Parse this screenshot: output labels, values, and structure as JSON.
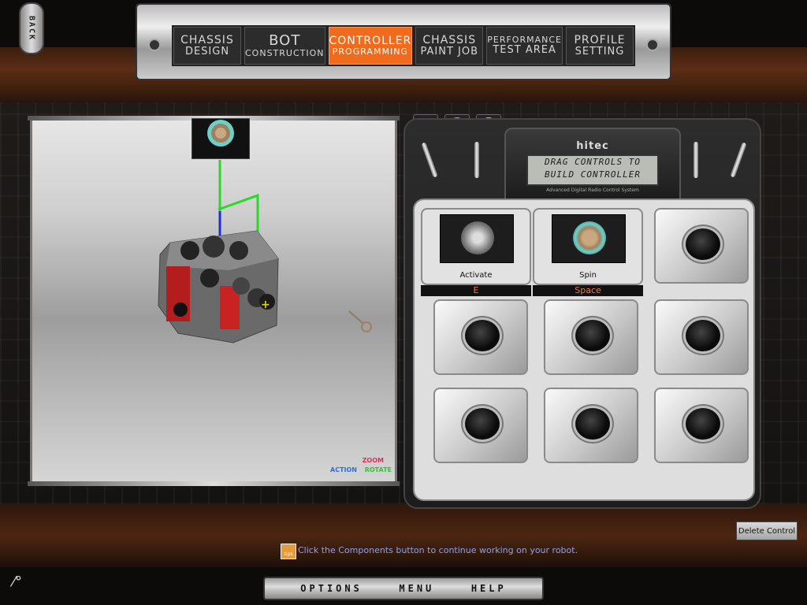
{
  "back": {
    "label": "BACK"
  },
  "nav": {
    "tabs": [
      {
        "line1": "CHASSIS",
        "line2": "DESIGN"
      },
      {
        "line1": "BOT",
        "line2": "CONSTRUCTION"
      },
      {
        "line1": "CONTROLLER",
        "line2": "PROGRAMMING"
      },
      {
        "line1": "CHASSIS",
        "line2": "PAINT JOB"
      },
      {
        "line1": "PERFORMANCE",
        "line2": "TEST AREA"
      },
      {
        "line1": "PROFILE",
        "line2": "SETTING"
      }
    ],
    "active_tab": "CONTROLLER PROGRAMMING"
  },
  "viewport": {
    "zoom_label": "ZOOM",
    "action_label": "ACTION",
    "rotate_label": "ROTATE"
  },
  "transmitter": {
    "brand": "hitec",
    "lcd_line1": "DRAG CONTROLS TO",
    "lcd_line2": "BUILD  CONTROLLER",
    "subtitle": "Advanced Digital Radio Control System",
    "controls": [
      {
        "label": "Activate",
        "key": "E"
      },
      {
        "label": "Spin",
        "key": "Space"
      }
    ]
  },
  "delete_button": {
    "label": "Delete Control"
  },
  "tip": {
    "icon": "tips",
    "text": "Click the Components button to continue working on your robot."
  },
  "bottom_nav": {
    "options": "OPTIONS",
    "menu": "MENU",
    "help": "HELP"
  },
  "colors": {
    "accent": "#f26a1b",
    "key_text": "#f07a30",
    "tip_text": "#8fa0e8"
  }
}
